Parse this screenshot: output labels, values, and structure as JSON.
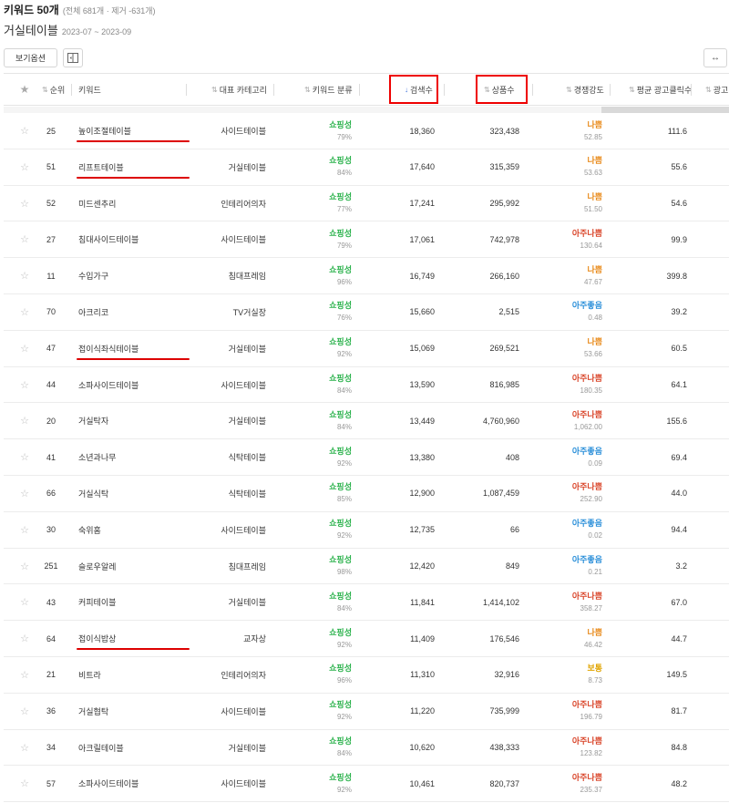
{
  "page": {
    "title": "키워드 50개",
    "title_meta": "(전체 681개 · 제거 -631개)",
    "subtitle": "거실테이블",
    "period": "2023-07 ~ 2023-09"
  },
  "toolbar": {
    "view_options_label": "보기옵션",
    "expand_label": "↔"
  },
  "columns": {
    "rank": "순위",
    "keyword": "키워드",
    "category": "대표 카테고리",
    "classification": "키워드 분류",
    "search": "검색수",
    "products": "상품수",
    "competition": "경쟁강도",
    "clicks": "평균 광고클릭수",
    "more": "광고"
  },
  "colors": {
    "good": "#2b8fd9",
    "bad": "#e88a1a",
    "very_bad": "#d9452a",
    "normal": "#e0a400",
    "shopping": "#2bb24c"
  },
  "rows": [
    {
      "rank": "25",
      "keyword": "높이조절테이블",
      "category": "사이드테이블",
      "type": "쇼핑성",
      "type_pct": "79%",
      "search": "18,360",
      "products": "323,438",
      "comp": "나쁨",
      "comp_level": "bad",
      "comp_val": "52.85",
      "clicks": "111.6"
    },
    {
      "rank": "51",
      "keyword": "리프트테이블",
      "category": "거실테이블",
      "type": "쇼핑성",
      "type_pct": "84%",
      "search": "17,640",
      "products": "315,359",
      "comp": "나쁨",
      "comp_level": "bad",
      "comp_val": "53.63",
      "clicks": "55.6"
    },
    {
      "rank": "52",
      "keyword": "미드센추리",
      "category": "인테리어의자",
      "type": "쇼핑성",
      "type_pct": "77%",
      "search": "17,241",
      "products": "295,992",
      "comp": "나쁨",
      "comp_level": "bad",
      "comp_val": "51.50",
      "clicks": "54.6"
    },
    {
      "rank": "27",
      "keyword": "침대사이드테이블",
      "category": "사이드테이블",
      "type": "쇼핑성",
      "type_pct": "79%",
      "search": "17,061",
      "products": "742,978",
      "comp": "아주나쁨",
      "comp_level": "very_bad",
      "comp_val": "130.64",
      "clicks": "99.9"
    },
    {
      "rank": "11",
      "keyword": "수입가구",
      "category": "침대프레임",
      "type": "쇼핑성",
      "type_pct": "96%",
      "search": "16,749",
      "products": "266,160",
      "comp": "나쁨",
      "comp_level": "bad",
      "comp_val": "47.67",
      "clicks": "399.8"
    },
    {
      "rank": "70",
      "keyword": "아크리코",
      "category": "TV거실장",
      "type": "쇼핑성",
      "type_pct": "76%",
      "search": "15,660",
      "products": "2,515",
      "comp": "아주좋음",
      "comp_level": "good",
      "comp_val": "0.48",
      "clicks": "39.2"
    },
    {
      "rank": "47",
      "keyword": "접이식좌식테이블",
      "category": "거실테이블",
      "type": "쇼핑성",
      "type_pct": "92%",
      "search": "15,069",
      "products": "269,521",
      "comp": "나쁨",
      "comp_level": "bad",
      "comp_val": "53.66",
      "clicks": "60.5"
    },
    {
      "rank": "44",
      "keyword": "소파사이드테이블",
      "category": "사이드테이블",
      "type": "쇼핑성",
      "type_pct": "84%",
      "search": "13,590",
      "products": "816,985",
      "comp": "아주나쁨",
      "comp_level": "very_bad",
      "comp_val": "180.35",
      "clicks": "64.1"
    },
    {
      "rank": "20",
      "keyword": "거실탁자",
      "category": "거실테이블",
      "type": "쇼핑성",
      "type_pct": "84%",
      "search": "13,449",
      "products": "4,760,960",
      "comp": "아주나쁨",
      "comp_level": "very_bad",
      "comp_val": "1,062.00",
      "clicks": "155.6"
    },
    {
      "rank": "41",
      "keyword": "소년과나무",
      "category": "식탁테이블",
      "type": "쇼핑성",
      "type_pct": "92%",
      "search": "13,380",
      "products": "408",
      "comp": "아주좋음",
      "comp_level": "good",
      "comp_val": "0.09",
      "clicks": "69.4"
    },
    {
      "rank": "66",
      "keyword": "거실식탁",
      "category": "식탁테이블",
      "type": "쇼핑성",
      "type_pct": "85%",
      "search": "12,900",
      "products": "1,087,459",
      "comp": "아주나쁨",
      "comp_level": "very_bad",
      "comp_val": "252.90",
      "clicks": "44.0"
    },
    {
      "rank": "30",
      "keyword": "숙위홈",
      "category": "사이드테이블",
      "type": "쇼핑성",
      "type_pct": "92%",
      "search": "12,735",
      "products": "66",
      "comp": "아주좋음",
      "comp_level": "good",
      "comp_val": "0.02",
      "clicks": "94.4"
    },
    {
      "rank": "251",
      "keyword": "슬로우알레",
      "category": "침대프레임",
      "type": "쇼핑성",
      "type_pct": "98%",
      "search": "12,420",
      "products": "849",
      "comp": "아주좋음",
      "comp_level": "good",
      "comp_val": "0.21",
      "clicks": "3.2"
    },
    {
      "rank": "43",
      "keyword": "커피테이블",
      "category": "거실테이블",
      "type": "쇼핑성",
      "type_pct": "84%",
      "search": "11,841",
      "products": "1,414,102",
      "comp": "아주나쁨",
      "comp_level": "very_bad",
      "comp_val": "358.27",
      "clicks": "67.0"
    },
    {
      "rank": "64",
      "keyword": "접이식밥상",
      "category": "교자상",
      "type": "쇼핑성",
      "type_pct": "92%",
      "search": "11,409",
      "products": "176,546",
      "comp": "나쁨",
      "comp_level": "bad",
      "comp_val": "46.42",
      "clicks": "44.7"
    },
    {
      "rank": "21",
      "keyword": "비트라",
      "category": "인테리어의자",
      "type": "쇼핑성",
      "type_pct": "96%",
      "search": "11,310",
      "products": "32,916",
      "comp": "보통",
      "comp_level": "normal",
      "comp_val": "8.73",
      "clicks": "149.5"
    },
    {
      "rank": "36",
      "keyword": "거실협탁",
      "category": "사이드테이블",
      "type": "쇼핑성",
      "type_pct": "92%",
      "search": "11,220",
      "products": "735,999",
      "comp": "아주나쁨",
      "comp_level": "very_bad",
      "comp_val": "196.79",
      "clicks": "81.7"
    },
    {
      "rank": "34",
      "keyword": "아크릴테이블",
      "category": "거실테이블",
      "type": "쇼핑성",
      "type_pct": "84%",
      "search": "10,620",
      "products": "438,333",
      "comp": "아주나쁨",
      "comp_level": "very_bad",
      "comp_val": "123.82",
      "clicks": "84.8"
    },
    {
      "rank": "57",
      "keyword": "소파사이드테이블",
      "category": "사이드테이블",
      "type": "쇼핑성",
      "type_pct": "92%",
      "search": "10,461",
      "products": "820,737",
      "comp": "아주나쁨",
      "comp_level": "very_bad",
      "comp_val": "235.37",
      "clicks": "48.2"
    }
  ]
}
